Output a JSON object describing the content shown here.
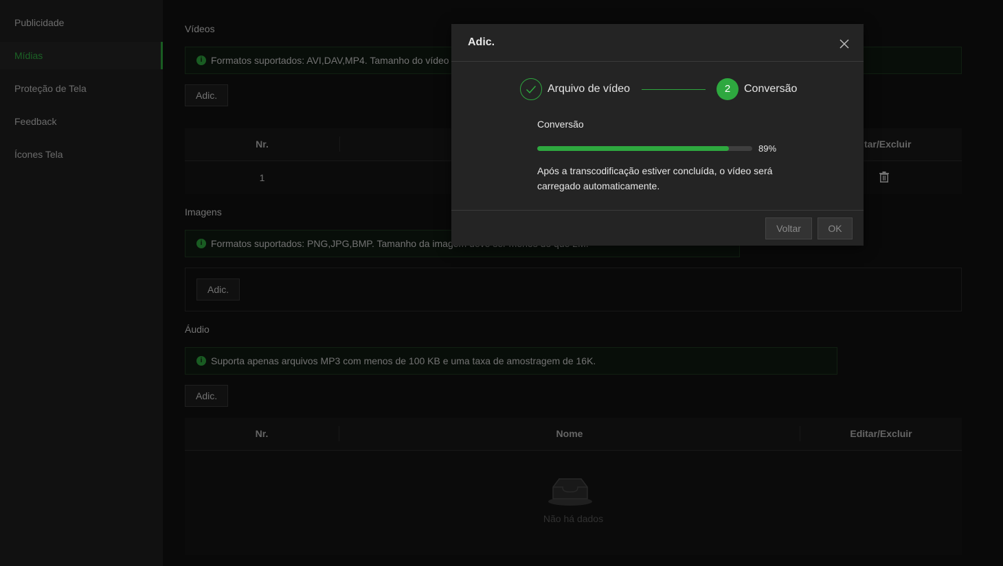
{
  "sidebar": {
    "items": [
      {
        "label": "Publicidade"
      },
      {
        "label": "Mídias"
      },
      {
        "label": "Proteção de Tela"
      },
      {
        "label": "Feedback"
      },
      {
        "label": "Ícones Tela"
      }
    ],
    "active_index": 1
  },
  "videos": {
    "title": "Vídeos",
    "info": "Formatos suportados: AVI,DAV,MP4. Tamanho do vídeo d",
    "add_label": "Adic.",
    "columns": [
      "Nr.",
      "",
      "ditar/Excluir"
    ],
    "rows": [
      {
        "nr": "1"
      }
    ]
  },
  "images": {
    "title": "Imagens",
    "info": "Formatos suportados: PNG,JPG,BMP. Tamanho da imagem deve ser menos do que 2M.",
    "add_label": "Adic."
  },
  "audio": {
    "title": "Áudio",
    "info": "Suporta apenas arquivos MP3 com menos de 100 KB e uma taxa de amostragem de 16K.",
    "add_label": "Adic.",
    "columns": [
      "Nr.",
      "Nome",
      "Editar/Excluir"
    ],
    "empty_text": "Não há dados"
  },
  "dialog": {
    "title": "Adic.",
    "steps": [
      {
        "label": "Arquivo de vídeo",
        "status": "done"
      },
      {
        "number": "2",
        "label": "Conversão",
        "status": "active"
      }
    ],
    "conversion_label": "Conversão",
    "progress_percent": 89,
    "progress_text": "89%",
    "note": "Após a transcodificação estiver concluída, o vídeo será carregado automaticamente.",
    "back_label": "Voltar",
    "ok_label": "OK"
  },
  "colors": {
    "accent": "#2ea83f",
    "sidebar_bg": "#1f1f1f",
    "dialog_bg": "#242424"
  },
  "icons": {
    "info": "info-icon",
    "close": "close-icon",
    "check": "check-icon",
    "delete": "trash-icon",
    "empty": "empty-inbox-icon"
  }
}
